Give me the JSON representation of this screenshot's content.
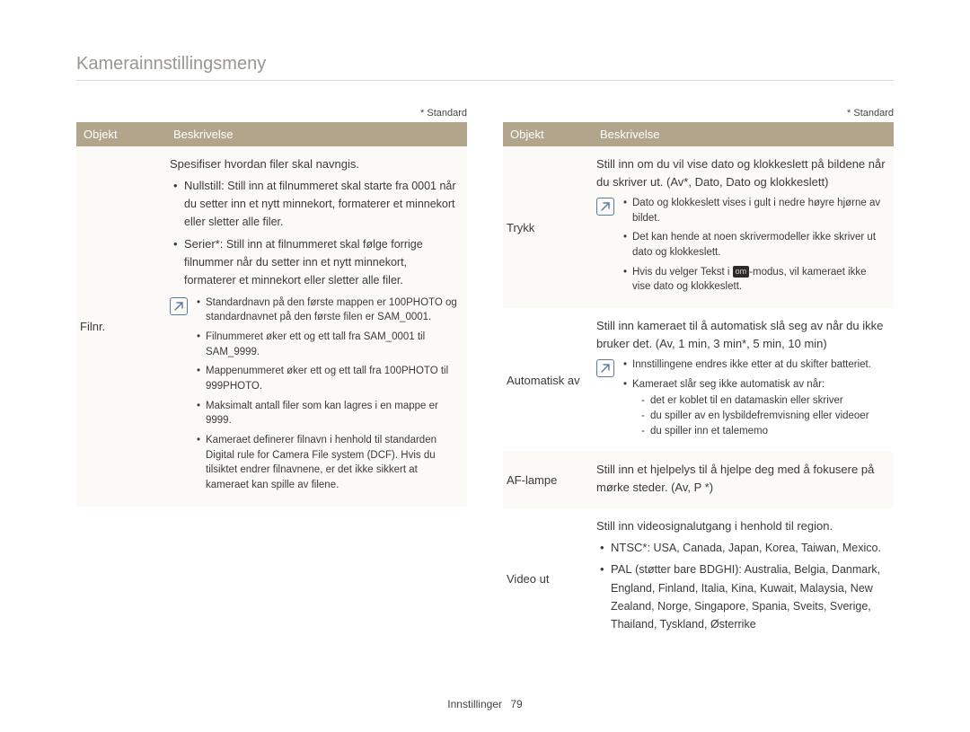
{
  "page": {
    "title": "Kamerainnstillingsmeny",
    "footer_label": "Innstillinger",
    "page_number": "79"
  },
  "left": {
    "standard": "* Standard",
    "headers": {
      "objekt": "Objekt",
      "beskrivelse": "Beskrivelse"
    },
    "rows": [
      {
        "objekt": "Filnr.",
        "intro": "Spesifiser hvordan filer skal navngis.",
        "bullets": [
          {
            "lead": "Nullstill:",
            "text": " Still inn at filnummeret skal starte fra 0001 når du setter inn et nytt minnekort, formaterer et minnekort eller sletter alle filer."
          },
          {
            "lead": "Serier*:",
            "text": " Still inn at filnummeret skal følge forrige filnummer når du setter inn et nytt minnekort, formaterer et minnekort eller sletter alle filer."
          }
        ],
        "notes": [
          "Standardnavn på den første mappen er 100PHOTO og standardnavnet på den første filen er SAM_0001.",
          "Filnummeret øker ett og ett tall fra SAM_0001 til SAM_9999.",
          "Mappenummeret øker ett og ett tall fra 100PHOTO til 999PHOTO.",
          "Maksimalt antall filer som kan lagres i en mappe er 9999.",
          "Kameraet definerer filnavn i henhold til standarden Digital rule for Camera File system (DCF). Hvis du tilsiktet endrer filnavnene, er det ikke sikkert at kameraet kan spille av filene."
        ]
      }
    ]
  },
  "right": {
    "standard": "* Standard",
    "headers": {
      "objekt": "Objekt",
      "beskrivelse": "Beskrivelse"
    },
    "rows": {
      "trykk": {
        "objekt": "Trykk",
        "intro": "Still inn om du vil vise dato og klokkeslett på bildene når du skriver ut. (Av*, Dato, Dato og klokkeslett)",
        "notes": [
          "Dato og klokkeslett vises i gult i nedre høyre hjørne av bildet.",
          "Det kan hende at noen skrivermodeller ikke skriver ut dato og klokkeslett."
        ],
        "note3_pre": "Hvis du velger Tekst i ",
        "note3_chip": "om",
        "note3_post": "-modus, vil kameraet ikke vise dato og klokkeslett."
      },
      "auto_av": {
        "objekt": "Automatisk av",
        "intro": "Still inn kameraet til å automatisk slå seg av når du ikke bruker det. (Av, 1 min, 3 min*, 5 min, 10 min)",
        "notes": [
          "Innstillingene endres ikke etter at du skifter batteriet."
        ],
        "note2_lead": "Kameraet slår seg ikke automatisk av når:",
        "note2_subs": [
          "det er koblet til en datamaskin eller skriver",
          "du spiller av en lysbildefremvisning eller videoer",
          "du spiller inn et talememo"
        ]
      },
      "af_lampe": {
        "objekt": "AF-lampe",
        "intro": "Still inn et hjelpelys til å hjelpe deg med å fokusere på mørke steder. (Av, P *)"
      },
      "video_ut": {
        "objekt": "Video ut",
        "intro": "Still inn videosignalutgang i henhold til region.",
        "bullets": [
          {
            "lead": "NTSC*:",
            "text": " USA, Canada, Japan, Korea, Taiwan, Mexico."
          },
          {
            "lead": "PAL",
            "lead2": " (støtter bare BDGHI):",
            "text": " Australia, Belgia, Danmark, England, Finland, Italia, Kina, Kuwait, Malaysia, New Zealand, Norge, Singapore, Spania, Sveits, Sverige, Thailand, Tyskland, Østerrike"
          }
        ]
      }
    }
  }
}
